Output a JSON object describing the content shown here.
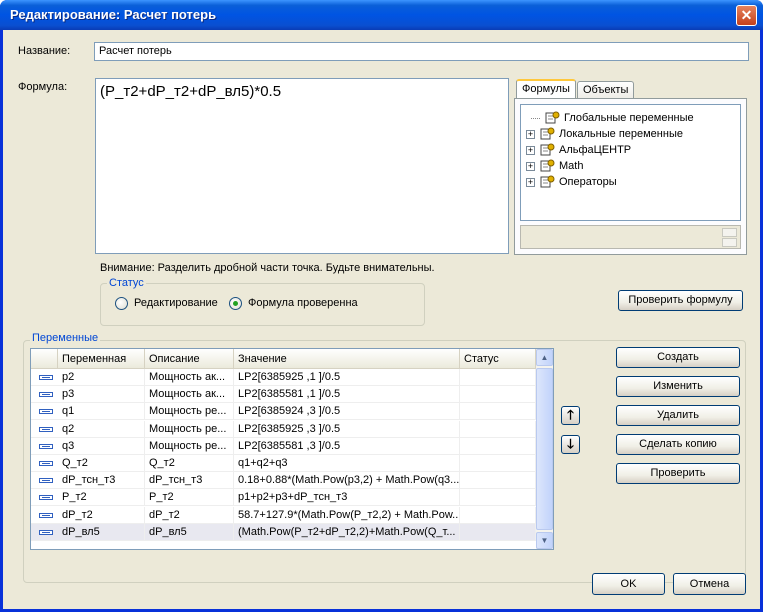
{
  "window": {
    "title": "Редактирование: Расчет потерь",
    "close_symbol": "✕"
  },
  "name_field": {
    "label": "Название:",
    "value": "Расчет потерь"
  },
  "formula_field": {
    "label": "Формула:",
    "value": "(P_т2+dP_т2+dP_вл5)*0.5"
  },
  "tabs": [
    {
      "label": "Формулы",
      "active": true
    },
    {
      "label": "Объекты",
      "active": false
    }
  ],
  "tree": {
    "items": [
      {
        "label": "Глобальные переменные",
        "expandable": false,
        "icon": "variable-gear-icon"
      },
      {
        "label": "Локальные переменные",
        "expandable": true,
        "icon": "variable-gear-icon"
      },
      {
        "label": "АльфаЦЕНТР",
        "expandable": true,
        "icon": "variable-gear-icon"
      },
      {
        "label": "Math",
        "expandable": true,
        "icon": "variable-gear-icon"
      },
      {
        "label": "Операторы",
        "expandable": true,
        "icon": "variable-gear-icon"
      }
    ],
    "expander_symbol": "+"
  },
  "warning": "Внимание: Разделить дробной части точка. Будьте внимательны.",
  "status_group": {
    "caption": "Статус",
    "options": [
      {
        "label": "Редактирование",
        "checked": false
      },
      {
        "label": "Формула проверенна",
        "checked": true
      }
    ]
  },
  "check_formula_button": "Проверить формулу",
  "variables_group": {
    "caption": "Переменные",
    "columns": [
      "",
      "Переменная",
      "Описание",
      "Значение",
      "Статус"
    ],
    "rows": [
      {
        "name": "p2",
        "desc": "Мощность ак...",
        "value": "LP2[6385925 ,1 ]/0.5",
        "status": ""
      },
      {
        "name": "p3",
        "desc": "Мощность ак...",
        "value": "LP2[6385581 ,1 ]/0.5",
        "status": ""
      },
      {
        "name": "q1",
        "desc": "Мощность ре...",
        "value": "LP2[6385924 ,3 ]/0.5",
        "status": ""
      },
      {
        "name": "q2",
        "desc": "Мощность ре...",
        "value": "LP2[6385925 ,3 ]/0.5",
        "status": ""
      },
      {
        "name": "q3",
        "desc": "Мощность ре...",
        "value": "LP2[6385581 ,3 ]/0.5",
        "status": ""
      },
      {
        "name": "Q_т2",
        "desc": "Q_т2",
        "value": "q1+q2+q3",
        "status": ""
      },
      {
        "name": "dP_тсн_т3",
        "desc": "dP_тсн_т3",
        "value": "0.18+0.88*(Math.Pow(p3,2) + Math.Pow(q3...",
        "status": ""
      },
      {
        "name": "P_т2",
        "desc": "P_т2",
        "value": "p1+p2+p3+dP_тсн_т3",
        "status": ""
      },
      {
        "name": "dP_т2",
        "desc": "dP_т2",
        "value": "58.7+127.9*(Math.Pow(P_т2,2) + Math.Pow...",
        "status": ""
      },
      {
        "name": "dP_вл5",
        "desc": "dP_вл5",
        "value": "(Math.Pow(P_т2+dP_т2,2)+Math.Pow(Q_т...",
        "status": "",
        "selected": true
      }
    ],
    "move_up_symbol": "🡑",
    "move_down_symbol": "🡓",
    "buttons": [
      "Создать",
      "Изменить",
      "Удалить",
      "Сделать копию",
      "Проверить"
    ]
  },
  "dialog_buttons": {
    "ok": "OK",
    "cancel": "Отмена"
  },
  "colors": {
    "title_bar": "#0054e3",
    "client_bg": "#ece9d8",
    "group_caption": "#0046d5",
    "radio_check": "#21a121"
  }
}
